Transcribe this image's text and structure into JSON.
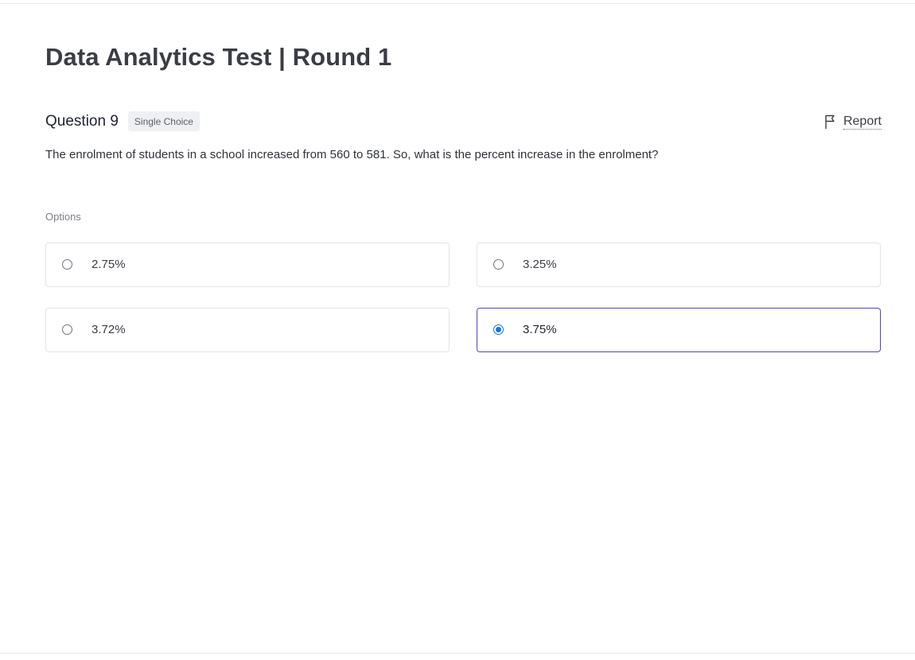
{
  "page": {
    "title": "Data Analytics Test | Round 1"
  },
  "question": {
    "number_label": "Question 9",
    "type_badge": "Single Choice",
    "text": "The enrolment of students in a school increased from 560 to 581. So, what is the percent increase in the enrolment?"
  },
  "report": {
    "label": "Report",
    "icon": "flag-icon"
  },
  "options": {
    "label": "Options",
    "items": [
      {
        "text": "2.75%",
        "selected": false
      },
      {
        "text": "3.25%",
        "selected": false
      },
      {
        "text": "3.72%",
        "selected": false
      },
      {
        "text": "3.75%",
        "selected": true
      }
    ]
  },
  "colors": {
    "selected_border": "#5b3fb5",
    "radio_selected": "#1a73e8"
  }
}
